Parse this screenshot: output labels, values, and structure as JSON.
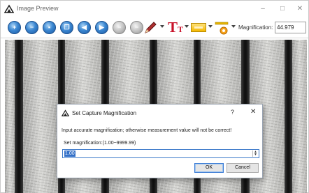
{
  "window": {
    "title": "Image Preview",
    "controls": {
      "minimize": "–",
      "maximize": "□",
      "close": "✕"
    }
  },
  "toolbar": {
    "buttons": [
      {
        "icon": "zoom-in-icon",
        "style": "blue"
      },
      {
        "icon": "zoom-out-icon",
        "style": "blue"
      },
      {
        "icon": "save-icon",
        "style": "blue"
      },
      {
        "icon": "copy-icon",
        "style": "blue"
      },
      {
        "icon": "previous-icon",
        "style": "blue"
      },
      {
        "icon": "next-icon",
        "style": "blue"
      },
      {
        "icon": "minus-icon",
        "style": "grey"
      },
      {
        "icon": "delete-icon",
        "style": "grey"
      }
    ],
    "tools": [
      "pencil-icon",
      "text-tool-icon",
      "color-swatch-icon",
      "line-width-icon"
    ],
    "magnification_label": "Magnification:",
    "magnification_value": "44.979"
  },
  "dialog": {
    "title": "Set Capture Magnification",
    "help": "?",
    "close": "✕",
    "message": "Input accurate magnification; otherwise measurement value will not be correct!",
    "field_label": "Set magnification:(1.00~9999.99)",
    "field_value": "1.00",
    "ok_label": "OK",
    "cancel_label": "Cancel"
  },
  "colors": {
    "accent_blue": "#3a86d1",
    "text_tool_red": "#c8122a",
    "color_swatch_yellow": "#f5b800",
    "selection_blue": "#3370c8"
  }
}
